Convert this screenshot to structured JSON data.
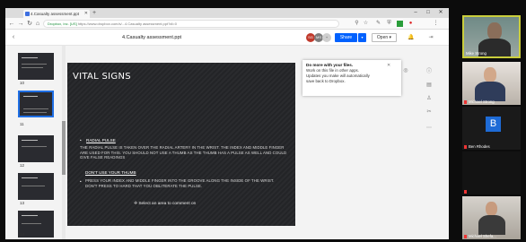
{
  "browser": {
    "tab_title": "4.Casualty assessment.ppt",
    "url_site": "Dropbox, Inc. [US]",
    "url_text": "https://www.dropbox.com/s/...4.Casualty assessment.ppt?dl=0",
    "new_tab": "+",
    "win_min": "–",
    "win_max": "□",
    "win_close": "✕"
  },
  "dropbox": {
    "doc_title": "4.Casualty assessment.ppt",
    "avatars": [
      "SG",
      "MS"
    ],
    "share_label": "Share",
    "open_label": "Open ▾"
  },
  "thumbnails": {
    "numbers": [
      "10",
      "11",
      "12",
      "13",
      "14"
    ],
    "selected": "11"
  },
  "slide": {
    "title": "VITAL SIGNS",
    "heading1": "Radial Pulse",
    "para1": "The radial pulse is taken over the radial artery in the wrist. The index and middle finger are used for this. You should not use a thumb as the thumb has a pulse as well and could give false readings",
    "heading2": "Don't Use Your Thumb",
    "para2": "Press your index and middle finger into the groove along the inside of the wrist. Don't press to hard that you obliterate the pulse.",
    "comment_prompt": "Select an area to comment on"
  },
  "popup": {
    "title": "Do more with your files.",
    "body": "Work on this file in other apps. Updates you make will automatically save back to Dropbox."
  },
  "participants": [
    {
      "name": "Mike Strong",
      "active": true
    },
    {
      "name": "Michael Strong",
      "active": false
    },
    {
      "name": "Ben Rhodes",
      "initial": "B",
      "active": false
    },
    {
      "name": "",
      "active": false
    },
    {
      "name": "",
      "active": false
    },
    {
      "name": "Michael Shefa...",
      "active": false
    }
  ],
  "colors": {
    "share_blue": "#0061fe",
    "active_speaker": "#c9cd3c",
    "selected_thumb": "#1f6fe5",
    "mic_muted": "#e33333"
  }
}
